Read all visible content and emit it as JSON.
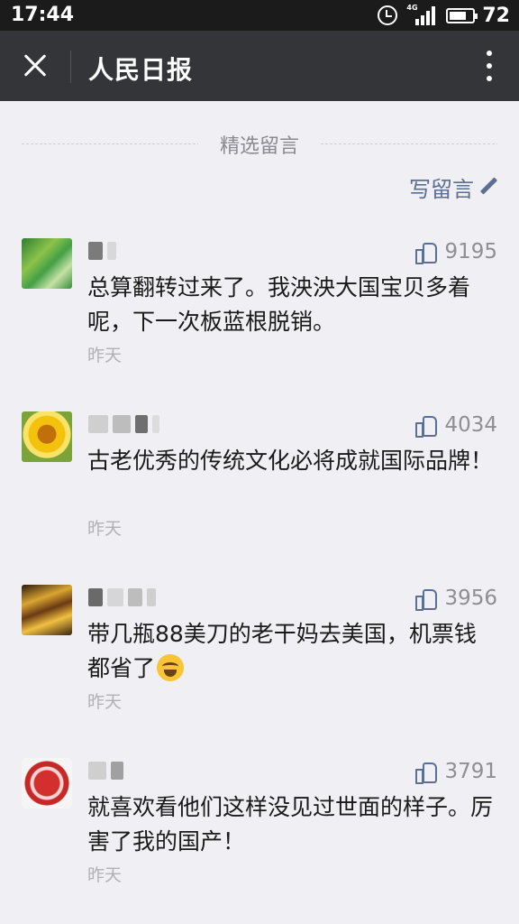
{
  "status_bar": {
    "time": "17:44",
    "network": "4G",
    "battery": "72",
    "icons": [
      "alarm-icon",
      "signal-icon",
      "battery-icon"
    ]
  },
  "header": {
    "title": "人民日报",
    "close_icon": "close-icon",
    "more_icon": "more-icon"
  },
  "section": {
    "title": "精选留言",
    "write_label": "写留言",
    "write_icon": "pencil-icon"
  },
  "colors": {
    "link": "#5b6f91",
    "title_bar": "#333538",
    "background": "#efeff4"
  },
  "comments": [
    {
      "likes": "9195",
      "text": "总算翻转过来了。我泱泱大国宝贝多着呢，下一次板蓝根脱销。",
      "time": "昨天"
    },
    {
      "likes": "4034",
      "text": "古老优秀的传统文化必将成就国际品牌！",
      "time": "昨天"
    },
    {
      "likes": "3956",
      "text": "带几瓶88美刀的老干妈去美国，机票钱都省了",
      "time": "昨天",
      "emoji": "laughing-tears-emoji"
    },
    {
      "likes": "3791",
      "text": "就喜欢看他们这样没见过世面的样子。厉害了我的国产！",
      "time": "昨天"
    }
  ]
}
